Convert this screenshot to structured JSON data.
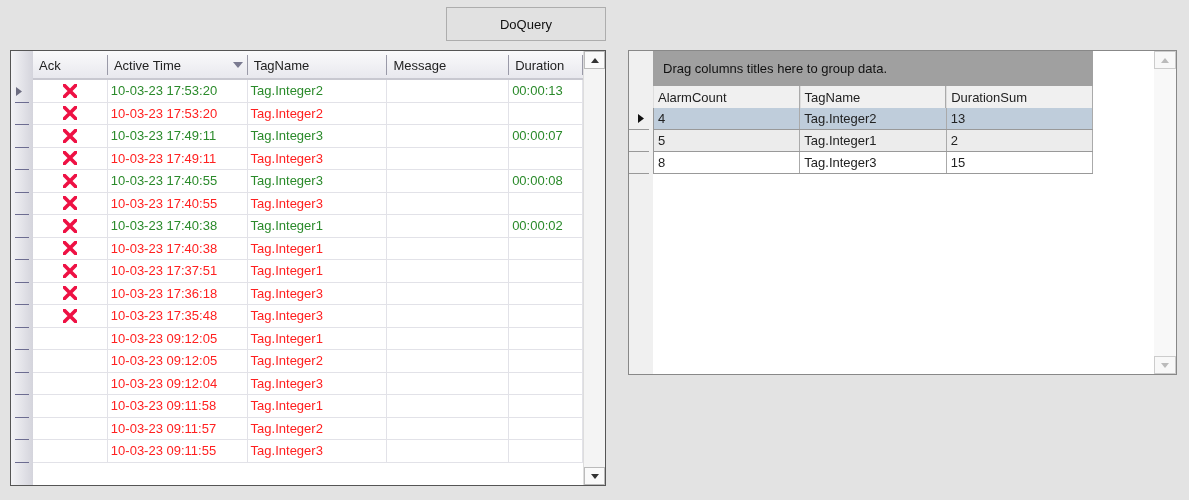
{
  "query_button": {
    "label": "DoQuery"
  },
  "alarm_grid": {
    "columns": [
      {
        "label": "Ack",
        "sorted": false
      },
      {
        "label": "Active Time",
        "sorted": true
      },
      {
        "label": "TagName",
        "sorted": false
      },
      {
        "label": "Message",
        "sorted": false
      },
      {
        "label": "Duration",
        "sorted": false
      }
    ],
    "rows": [
      {
        "selected": true,
        "acked": true,
        "color": "#2a8a2a",
        "time": "10-03-23 17:53:20",
        "tag": "Tag.Integer2",
        "duration": "00:00:13"
      },
      {
        "selected": false,
        "acked": true,
        "color": "#ff2020",
        "time": "10-03-23 17:53:20",
        "tag": "Tag.Integer2"
      },
      {
        "selected": false,
        "acked": true,
        "color": "#2a8a2a",
        "time": "10-03-23 17:49:11",
        "tag": "Tag.Integer3",
        "duration": "00:00:07"
      },
      {
        "selected": false,
        "acked": true,
        "color": "#ff2020",
        "time": "10-03-23 17:49:11",
        "tag": "Tag.Integer3"
      },
      {
        "selected": false,
        "acked": true,
        "color": "#2a8a2a",
        "time": "10-03-23 17:40:55",
        "tag": "Tag.Integer3",
        "duration": "00:00:08"
      },
      {
        "selected": false,
        "acked": true,
        "color": "#ff2020",
        "time": "10-03-23 17:40:55",
        "tag": "Tag.Integer3"
      },
      {
        "selected": false,
        "acked": true,
        "color": "#2a8a2a",
        "time": "10-03-23 17:40:38",
        "tag": "Tag.Integer1",
        "duration": "00:00:02"
      },
      {
        "selected": false,
        "acked": true,
        "color": "#ff2020",
        "time": "10-03-23 17:40:38",
        "tag": "Tag.Integer1"
      },
      {
        "selected": false,
        "acked": true,
        "color": "#ff2020",
        "time": "10-03-23 17:37:51",
        "tag": "Tag.Integer1"
      },
      {
        "selected": false,
        "acked": true,
        "color": "#ff2020",
        "time": "10-03-23 17:36:18",
        "tag": "Tag.Integer3"
      },
      {
        "selected": false,
        "acked": true,
        "color": "#ff2020",
        "time": "10-03-23 17:35:48",
        "tag": "Tag.Integer3"
      },
      {
        "selected": false,
        "acked": false,
        "color": "#ff2020",
        "time": "10-03-23 09:12:05",
        "tag": "Tag.Integer1"
      },
      {
        "selected": false,
        "acked": false,
        "color": "#ff2020",
        "time": "10-03-23 09:12:05",
        "tag": "Tag.Integer2"
      },
      {
        "selected": false,
        "acked": false,
        "color": "#ff2020",
        "time": "10-03-23 09:12:04",
        "tag": "Tag.Integer3"
      },
      {
        "selected": false,
        "acked": false,
        "color": "#ff2020",
        "time": "10-03-23 09:11:58",
        "tag": "Tag.Integer1"
      },
      {
        "selected": false,
        "acked": false,
        "color": "#ff2020",
        "time": "10-03-23 09:11:57",
        "tag": "Tag.Integer2"
      },
      {
        "selected": false,
        "acked": false,
        "color": "#ff2020",
        "time": "10-03-23 09:11:55",
        "tag": "Tag.Integer3"
      }
    ]
  },
  "summary_grid": {
    "group_panel": "Drag columns titles here to group data.",
    "columns": [
      "AlarmCount",
      "TagName",
      "DurationSum"
    ],
    "rows": [
      {
        "selected": true,
        "hovered": false,
        "cells": [
          "4",
          "Tag.Integer2",
          "13"
        ]
      },
      {
        "selected": false,
        "hovered": true,
        "cells": [
          "5",
          "Tag.Integer1",
          "2"
        ]
      },
      {
        "selected": false,
        "hovered": false,
        "cells": [
          "8",
          "Tag.Integer3",
          "15"
        ]
      }
    ]
  }
}
